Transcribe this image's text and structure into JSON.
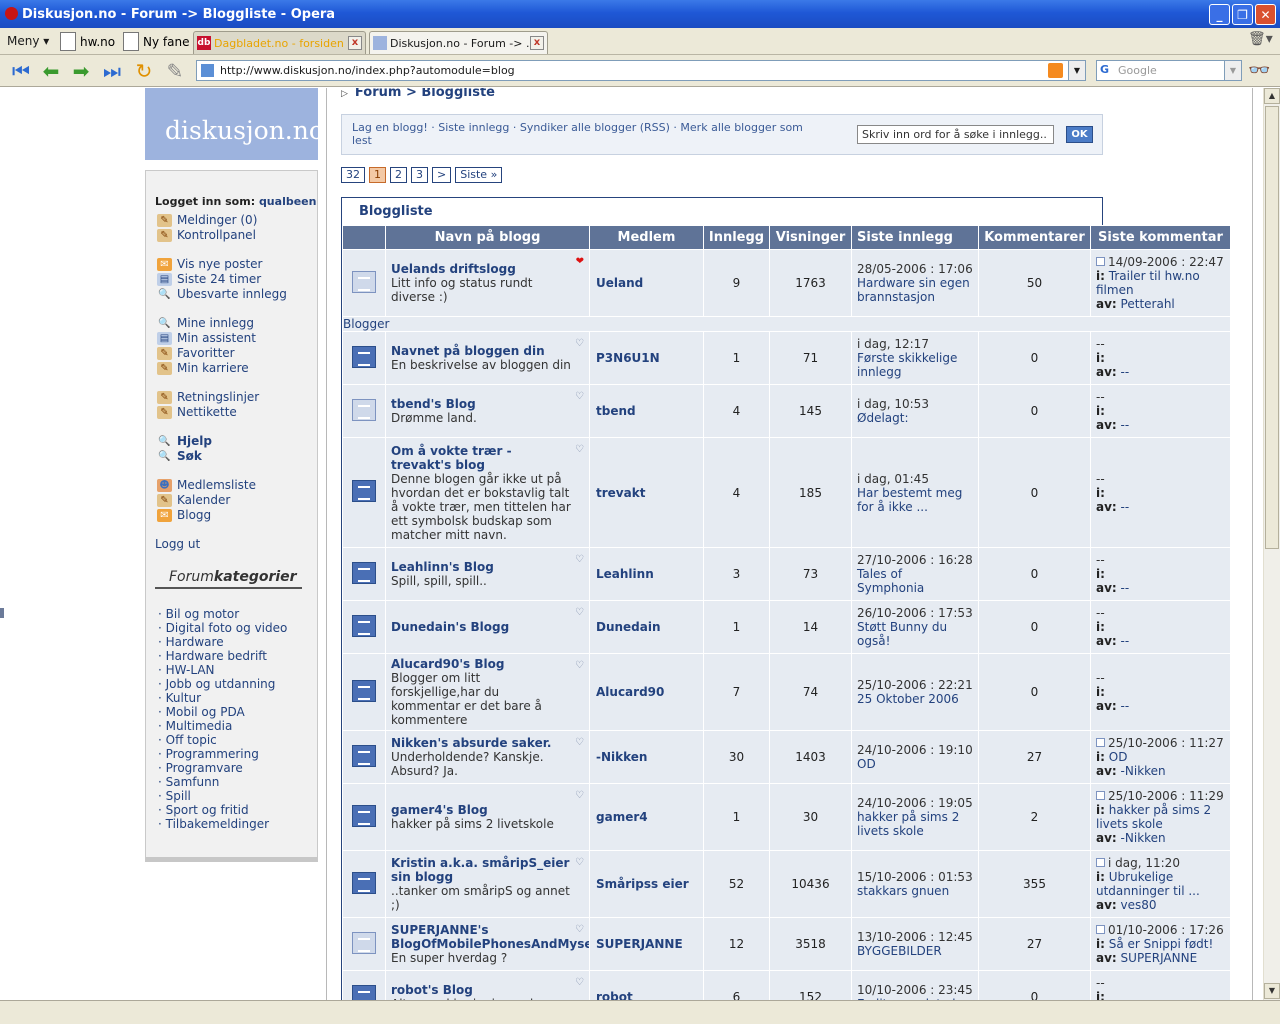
{
  "window": {
    "title": "Diskusjon.no - Forum -> Bloggliste - Opera"
  },
  "tabbar": {
    "menu": "Meny",
    "pinned": [
      "hw.no",
      "Ny fane"
    ],
    "tabs": [
      {
        "label": "Dagbladet.no - forsiden",
        "favicon": "db"
      },
      {
        "label": "Diskusjon.no - Forum -> ...",
        "favicon": ""
      }
    ]
  },
  "navbar": {
    "url": "http://www.diskusjon.no/index.php?automodule=blog",
    "search_placeholder": "Google",
    "search_engine": "G"
  },
  "logo": "diskusjon.no",
  "sidebar": {
    "logged_in_label": "Logget inn som:",
    "username": "qualbeen",
    "groups": [
      [
        {
          "label": "Meldinger (0)",
          "icon": "pen"
        },
        {
          "label": "Kontrollpanel",
          "icon": "pen"
        }
      ],
      [
        {
          "label": "Vis nye poster",
          "icon": "mail"
        },
        {
          "label": "Siste 24 timer",
          "icon": "doc"
        },
        {
          "label": "Ubesvarte innlegg",
          "icon": "key"
        }
      ],
      [
        {
          "label": "Mine innlegg",
          "icon": "key"
        },
        {
          "label": "Min assistent",
          "icon": "doc"
        },
        {
          "label": "Favoritter",
          "icon": "pen"
        },
        {
          "label": "Min karriere",
          "icon": "pen"
        }
      ],
      [
        {
          "label": "Retningslinjer",
          "icon": "pen"
        },
        {
          "label": "Nettikette",
          "icon": "pen"
        }
      ],
      [
        {
          "label": "Hjelp",
          "icon": "key",
          "bold": true
        },
        {
          "label": "Søk",
          "icon": "key",
          "bold": true
        }
      ],
      [
        {
          "label": "Medlemsliste",
          "icon": "ppl"
        },
        {
          "label": "Kalender",
          "icon": "pen"
        },
        {
          "label": "Blogg",
          "icon": "mail"
        }
      ]
    ],
    "logout": "Logg ut",
    "categories_title_a": "Forum",
    "categories_title_b": "kategorier",
    "categories": [
      "Bil og motor",
      "Digital foto og video",
      "Hardware",
      "Hardware bedrift",
      "HW-LAN",
      "Jobb og utdanning",
      "Kultur",
      "Mobil og PDA",
      "Multimedia",
      "Off topic",
      "Programmering",
      "Programvare",
      "Samfunn",
      "Spill",
      "Sport og fritid",
      "Tilbakemeldinger"
    ]
  },
  "breadcrumb": {
    "root": "Forum",
    "sep": ">",
    "current": "Bloggliste"
  },
  "toolbox": {
    "links": "Lag en blogg! · Siste innlegg · Syndiker alle blogger (RSS) · Merk alle blogger som lest",
    "search_value": "Skriv inn ord for å søke i innlegg..",
    "ok": "OK"
  },
  "pager": [
    "32",
    "1",
    "2",
    "3",
    ">",
    "Siste »"
  ],
  "pager_current": "1",
  "table": {
    "title": "Bloggliste",
    "headers": [
      "Navn på blogg",
      "Medlem",
      "Innlegg",
      "Visninger",
      "Siste innlegg",
      "Kommentarer",
      "Siste kommentar"
    ],
    "section_label": "Blogger",
    "comment_i": "i:",
    "comment_av": "av:",
    "pinned": {
      "name": "Uelands driftslogg",
      "desc": "Litt info og status rundt diverse :)",
      "member": "Ueland",
      "posts": "9",
      "views": "1763",
      "last_date": "28/05-2006 : 17:06",
      "last_title": "Hardware sin egen brannstasjon",
      "comments": "50",
      "lc_date": "14/09-2006 : 22:47",
      "lc_title": "Trailer til hw.no filmen",
      "lc_by": "Petterahl"
    },
    "rows": [
      {
        "name": "Navnet på bloggen din",
        "desc": "En beskrivelse av bloggen din",
        "member": "P3N6U1N",
        "posts": "1",
        "views": "71",
        "last_date": "i dag, 12:17",
        "last_title": "Første skikkelige innlegg",
        "comments": "0",
        "lc_date": "--",
        "lc_title": "",
        "lc_by": "--",
        "new": true
      },
      {
        "name": "tbend's Blog",
        "desc": "Drømme land.",
        "member": "tbend",
        "posts": "4",
        "views": "145",
        "last_date": "i dag, 10:53",
        "last_title": "Ødelagt:",
        "comments": "0",
        "lc_date": "--",
        "lc_title": "",
        "lc_by": "--",
        "new": false
      },
      {
        "name": "Om å vokte trær - trevakt's blog",
        "desc": "Denne blogen går ikke ut på hvordan det er bokstavlig talt å vokte trær, men tittelen har ett symbolsk budskap som matcher mitt navn.",
        "member": "trevakt",
        "posts": "4",
        "views": "185",
        "last_date": "i dag, 01:45",
        "last_title": "Har bestemt meg for å ikke ...",
        "comments": "0",
        "lc_date": "--",
        "lc_title": "",
        "lc_by": "--",
        "new": true
      },
      {
        "name": "Leahlinn's Blog",
        "desc": "Spill, spill, spill..",
        "member": "Leahlinn",
        "posts": "3",
        "views": "73",
        "last_date": "27/10-2006 : 16:28",
        "last_title": "Tales of Symphonia",
        "comments": "0",
        "lc_date": "--",
        "lc_title": "",
        "lc_by": "--",
        "new": true
      },
      {
        "name": "Dunedain's Blogg",
        "desc": "",
        "member": "Dunedain",
        "posts": "1",
        "views": "14",
        "last_date": "26/10-2006 : 17:53",
        "last_title": "Støtt Bunny du også!",
        "comments": "0",
        "lc_date": "--",
        "lc_title": "",
        "lc_by": "--",
        "new": true
      },
      {
        "name": "Alucard90's Blog",
        "desc": "Blogger om litt forskjellige,har du kommentar er det bare å kommentere",
        "member": "Alucard90",
        "posts": "7",
        "views": "74",
        "last_date": "25/10-2006 : 22:21",
        "last_title": "25 Oktober 2006",
        "comments": "0",
        "lc_date": "--",
        "lc_title": "",
        "lc_by": "--",
        "new": true
      },
      {
        "name": "Nikken's absurde saker.",
        "desc": "Underholdende? Kanskje. Absurd? Ja.",
        "member": "-Nikken",
        "posts": "30",
        "views": "1403",
        "last_date": "24/10-2006 : 19:10",
        "last_title": "OD",
        "comments": "27",
        "lc_date": "25/10-2006 : 11:27",
        "lc_title": "OD",
        "lc_by": "-Nikken",
        "new": true
      },
      {
        "name": "gamer4's Blog",
        "desc": "hakker på sims 2 livetskole",
        "member": "gamer4",
        "posts": "1",
        "views": "30",
        "last_date": "24/10-2006 : 19:05",
        "last_title": "hakker på sims 2 livets skole",
        "comments": "2",
        "lc_date": "25/10-2006 : 11:29",
        "lc_title": "hakker på sims 2 livets skole",
        "lc_by": "-Nikken",
        "new": true
      },
      {
        "name": "Kristin a.k.a. småripS_eier sin blogg",
        "desc": "..tanker om småripS og annet ;)",
        "member": "Småripss eier",
        "posts": "52",
        "views": "10436",
        "last_date": "15/10-2006 : 01:53",
        "last_title": "stakkars gnuen",
        "comments": "355",
        "lc_date": "i dag, 11:20",
        "lc_title": "Ubrukelige utdanninger til ...",
        "lc_by": "ves80",
        "new": true
      },
      {
        "name": "SUPERJANNE's BlogOfMobilePhonesAndMyself",
        "desc": "En super hverdag ?",
        "member": "SUPERJANNE",
        "posts": "12",
        "views": "3518",
        "last_date": "13/10-2006 : 12:45",
        "last_title": "BYGGEBILDER",
        "comments": "27",
        "lc_date": "01/10-2006 : 17:26",
        "lc_title": "Så er Snippi født!",
        "lc_by": "SUPERJANNE",
        "new": false
      },
      {
        "name": "robot's Blog",
        "desc": "Alt som skjer i min verden",
        "member": "robot",
        "posts": "6",
        "views": "152",
        "last_date": "10/10-2006 : 23:45",
        "last_title": "En liten update her",
        "comments": "0",
        "lc_date": "--",
        "lc_title": "",
        "lc_by": "--",
        "new": true
      }
    ]
  }
}
